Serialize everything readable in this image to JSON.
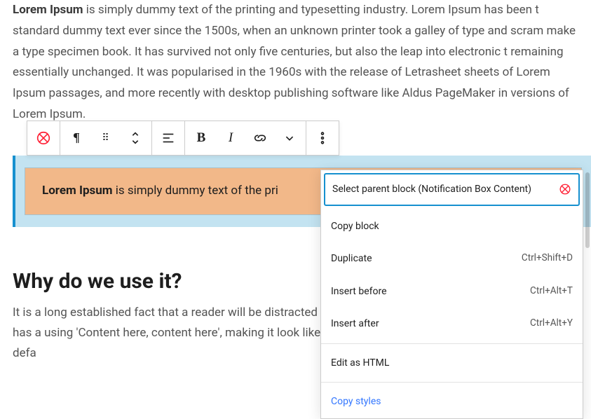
{
  "para1": {
    "lead": "Lorem Ipsum",
    "rest": " is simply dummy text of the printing and typesetting industry. Lorem Ipsum has been t standard dummy text ever since the 1500s, when an unknown printer took a galley of type and scram make a type specimen book. It has survived not only five centuries, but also the leap into electronic t remaining essentially unchanged. It was popularised in the 1960s with the release of Letrasheet sheets of Lorem Ipsum passages, and more recently with desktop publishing software like Aldus PageMaker in versions of Lorem Ipsum."
  },
  "toolbar": {
    "bold": "B",
    "italic": "I"
  },
  "notif": {
    "lead": "Lorem Ipsum",
    "rest": " is simply dummy text of the pri"
  },
  "heading": "Why do we use it?",
  "para2": "It is a long established fact that a reader will be distracted layout. The point of using Lorem Ipsum is that it has a using 'Content here, content here', making it look like web page editors now use Lorem Ipsum as their defa",
  "menu": {
    "parent": "Select parent block (Notification Box Content)",
    "copy": "Copy block",
    "duplicate": "Duplicate",
    "duplicate_sc": "Ctrl+Shift+D",
    "insert_before": "Insert before",
    "insert_before_sc": "Ctrl+Alt+T",
    "insert_after": "Insert after",
    "insert_after_sc": "Ctrl+Alt+Y",
    "edit_html": "Edit as HTML",
    "copy_styles": "Copy styles"
  }
}
